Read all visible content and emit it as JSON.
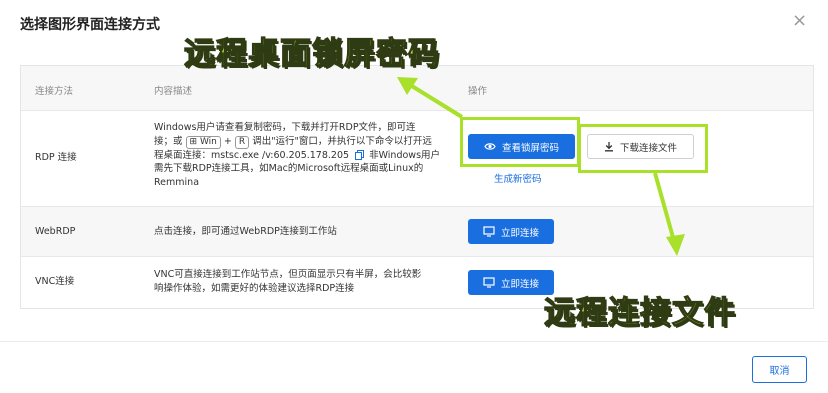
{
  "dialog": {
    "title": "选择图形界面连接方式",
    "close_symbol": "×",
    "cancel_label": "取消"
  },
  "table": {
    "headers": {
      "method": "连接方法",
      "desc": "内容描述",
      "action": "操作"
    },
    "rows": [
      {
        "method": "RDP 连接",
        "desc_line1": "Windows用户请查看复制密码，下载并打开RDP文件，即可连",
        "desc_l2_a": "接；或",
        "key_win": "⊞ Win",
        "plus": "+",
        "key_r": "R",
        "desc_l2_b": "调出\"运行\"窗口，并执行以下命令以打开远",
        "desc_l3_a": "程桌面连接：mstsc.exe /v:60.205.178.205",
        "desc_l3_b": "非Windows用户",
        "desc_line4": "需先下载RDP连接工具，如Mac的Microsoft远程桌面或Linux的",
        "desc_line5": "Remmina",
        "btn_view_password": "查看锁屏密码",
        "btn_download": "下载连接文件",
        "link_generate": "生成新密码"
      },
      {
        "method": "WebRDP",
        "desc": "点击连接，即可通过WebRDP连接到工作站",
        "btn": "立即连接"
      },
      {
        "method": "VNC连接",
        "desc_line1": "VNC可直接连接到工作站节点，但页面显示只有半屏，会比较影",
        "desc_line2": "响操作体验，如需更好的体验建议选择RDP连接",
        "btn": "立即连接"
      }
    ]
  },
  "annotations": {
    "top": "远程桌面锁屏密码",
    "bottom": "远程连接文件"
  },
  "colors": {
    "primary": "#1a6fe0",
    "highlight": "#a8e02a"
  }
}
